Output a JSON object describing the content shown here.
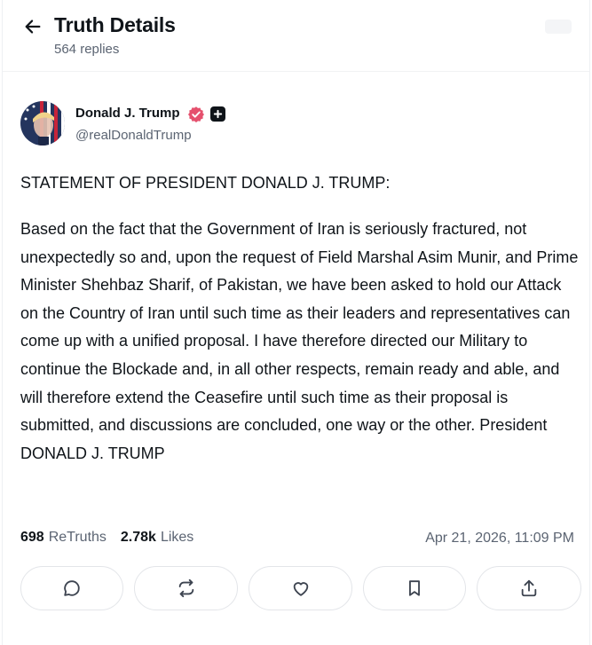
{
  "header": {
    "title": "Truth Details",
    "reply_count": "564 replies"
  },
  "post": {
    "author": {
      "name": "Donald J. Trump",
      "handle": "@realDonaldTrump"
    },
    "statement_title": "STATEMENT OF PRESIDENT DONALD J. TRUMP:",
    "body": "Based on the fact that the Government of Iran is seriously fractured, not unexpectedly so and, upon the request of Field Marshal Asim Munir, and Prime Minister Shehbaz Sharif, of Pakistan, we have been asked to hold our Attack on the Country of Iran until such time as their leaders and representatives can come up with a unified proposal. I have therefore directed our Military to continue the Blockade and, in all other respects, remain ready and able, and will therefore extend the Ceasefire until such time as their proposal is submitted, and discussions are concluded, one way or the other. President DONALD J. TRUMP",
    "stats": {
      "retruths_count": "698",
      "retruths_label": "ReTruths",
      "likes_count": "2.78k",
      "likes_label": "Likes"
    },
    "timestamp": "Apr 21, 2026, 11:09 PM"
  },
  "actions": [
    {
      "icon": "reply-icon"
    },
    {
      "icon": "retruth-icon"
    },
    {
      "icon": "heart-icon"
    },
    {
      "icon": "bookmark-icon"
    },
    {
      "icon": "share-icon"
    }
  ],
  "colors": {
    "verified": "#e5506d",
    "text": "#0f1419",
    "muted": "#5b6472",
    "border": "#e3e5e9"
  }
}
